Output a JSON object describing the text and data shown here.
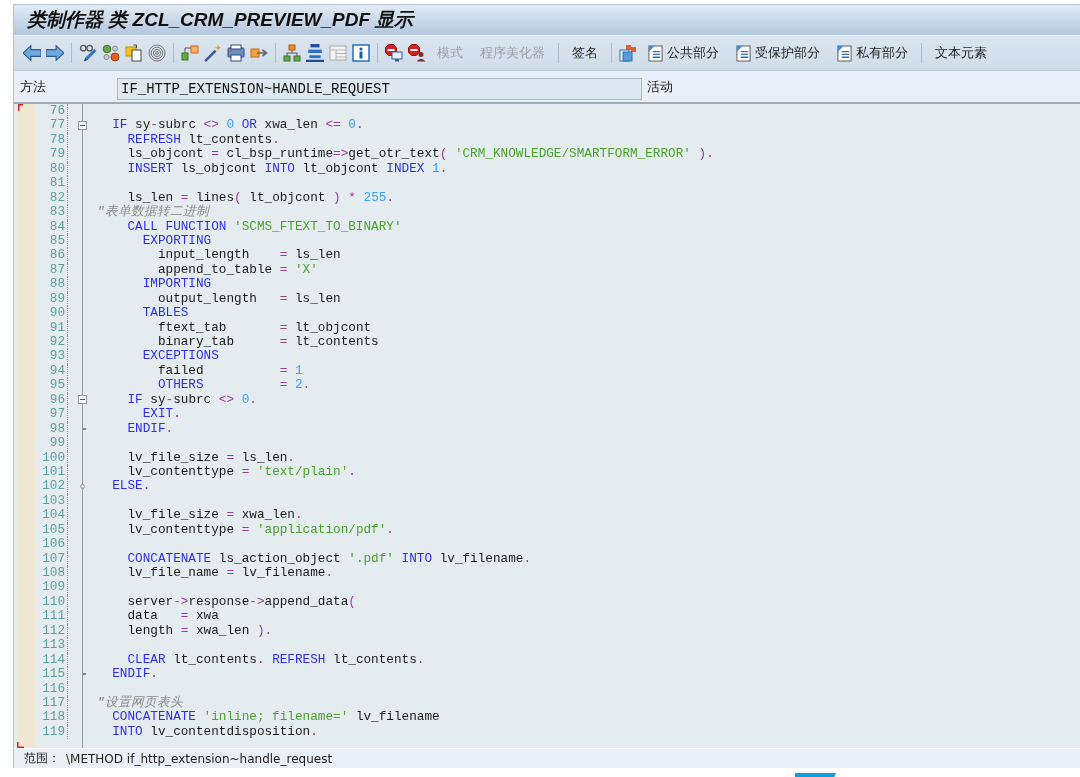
{
  "window": {
    "title": "类制作器 类 ZCL_CRM_PREVIEW_PDF 显示"
  },
  "toolbar": {
    "groups": [
      {
        "buttons": [
          {
            "label": "模式",
            "kind": "plain",
            "disabled": true
          },
          {
            "label": "程序美化器",
            "kind": "plain",
            "disabled": true
          }
        ]
      },
      {
        "buttons": [
          {
            "label": "签名",
            "kind": "plain",
            "disabled": false
          }
        ]
      },
      {
        "buttons": [
          {
            "label": "公共部分",
            "kind": "section",
            "disabled": false
          },
          {
            "label": "受保护部分",
            "kind": "section",
            "disabled": false
          },
          {
            "label": "私有部分",
            "kind": "section",
            "disabled": false
          }
        ]
      },
      {
        "buttons": [
          {
            "label": "文本元素",
            "kind": "plain",
            "disabled": false
          }
        ]
      }
    ]
  },
  "method": {
    "label": "方法",
    "value": "IF_HTTP_EXTENSION~HANDLE_REQUEST",
    "status": "活动"
  },
  "editor": {
    "lines": [
      {
        "number": "76",
        "kind": "line"
      },
      {
        "number": "77",
        "kind": "start",
        "tokens": [
          {
            "kind": "keyword",
            "text": "  IF"
          },
          {
            "kind": "plain",
            "text": " sy"
          },
          {
            "kind": "operator",
            "text": "-"
          },
          {
            "kind": "plain",
            "text": "subrc "
          },
          {
            "kind": "operator",
            "text": "<> "
          },
          {
            "kind": "number",
            "text": "0 "
          },
          {
            "kind": "keyword",
            "text": "OR"
          },
          {
            "kind": "plain",
            "text": " xwa_len "
          },
          {
            "kind": "operator",
            "text": "<= "
          },
          {
            "kind": "number",
            "text": "0"
          },
          {
            "kind": "operator",
            "text": "."
          }
        ]
      },
      {
        "number": "78",
        "kind": "line",
        "tokens": [
          {
            "kind": "keyword",
            "text": "    REFRESH"
          },
          {
            "kind": "plain",
            "text": " lt_contents"
          },
          {
            "kind": "operator",
            "text": "."
          }
        ]
      },
      {
        "number": "79",
        "kind": "line",
        "tokens": [
          {
            "kind": "plain",
            "text": "    ls_objcont "
          },
          {
            "kind": "operator",
            "text": "= "
          },
          {
            "kind": "plain",
            "text": "cl_bsp_runtime"
          },
          {
            "kind": "operator",
            "text": "=>"
          },
          {
            "kind": "plain",
            "text": "get_otr_text"
          },
          {
            "kind": "operator",
            "text": "( "
          },
          {
            "kind": "string",
            "text": "'CRM_KNOWLEDGE/SMARTFORM_ERROR'"
          },
          {
            "kind": "operator",
            "text": " )."
          }
        ]
      },
      {
        "number": "80",
        "kind": "line",
        "tokens": [
          {
            "kind": "keyword",
            "text": "    INSERT"
          },
          {
            "kind": "plain",
            "text": " ls_objcont "
          },
          {
            "kind": "keyword",
            "text": "INTO"
          },
          {
            "kind": "plain",
            "text": " lt_objcont "
          },
          {
            "kind": "keyword",
            "text": "INDEX"
          },
          {
            "kind": "number",
            "text": " 1"
          },
          {
            "kind": "operator",
            "text": "."
          }
        ]
      },
      {
        "number": "81",
        "kind": "line"
      },
      {
        "number": "82",
        "kind": "line",
        "tokens": [
          {
            "kind": "plain",
            "text": "    ls_len "
          },
          {
            "kind": "operator",
            "text": "= "
          },
          {
            "kind": "plain",
            "text": "lines"
          },
          {
            "kind": "operator",
            "text": "( "
          },
          {
            "kind": "plain",
            "text": "lt_objcont "
          },
          {
            "kind": "operator",
            "text": ") * "
          },
          {
            "kind": "number",
            "text": "255"
          },
          {
            "kind": "operator",
            "text": "."
          }
        ]
      },
      {
        "number": "83",
        "kind": "line",
        "tokens": [
          {
            "kind": "comment",
            "text": "\"表单数据转二进制"
          }
        ]
      },
      {
        "number": "84",
        "kind": "line",
        "tokens": [
          {
            "kind": "keyword",
            "text": "    CALL FUNCTION"
          },
          {
            "kind": "string",
            "text": " 'SCMS_FTEXT_TO_BINARY'"
          }
        ]
      },
      {
        "number": "85",
        "kind": "line",
        "tokens": [
          {
            "kind": "keyword",
            "text": "      EXPORTING"
          }
        ]
      },
      {
        "number": "86",
        "kind": "line",
        "tokens": [
          {
            "kind": "plain",
            "text": "        input_length    "
          },
          {
            "kind": "operator",
            "text": "= "
          },
          {
            "kind": "plain",
            "text": "ls_len"
          }
        ]
      },
      {
        "number": "87",
        "kind": "line",
        "tokens": [
          {
            "kind": "plain",
            "text": "        append_to_table "
          },
          {
            "kind": "operator",
            "text": "= "
          },
          {
            "kind": "string",
            "text": "'X'"
          }
        ]
      },
      {
        "number": "88",
        "kind": "line",
        "tokens": [
          {
            "kind": "keyword",
            "text": "      IMPORTING"
          }
        ]
      },
      {
        "number": "89",
        "kind": "line",
        "tokens": [
          {
            "kind": "plain",
            "text": "        output_length   "
          },
          {
            "kind": "operator",
            "text": "= "
          },
          {
            "kind": "plain",
            "text": "ls_len"
          }
        ]
      },
      {
        "number": "90",
        "kind": "line",
        "tokens": [
          {
            "kind": "keyword",
            "text": "      TABLES"
          }
        ]
      },
      {
        "number": "91",
        "kind": "line",
        "tokens": [
          {
            "kind": "plain",
            "text": "        ftext_tab       "
          },
          {
            "kind": "operator",
            "text": "= "
          },
          {
            "kind": "plain",
            "text": "lt_objcont"
          }
        ]
      },
      {
        "number": "92",
        "kind": "line",
        "tokens": [
          {
            "kind": "plain",
            "text": "        binary_tab      "
          },
          {
            "kind": "operator",
            "text": "= "
          },
          {
            "kind": "plain",
            "text": "lt_contents"
          }
        ]
      },
      {
        "number": "93",
        "kind": "line",
        "tokens": [
          {
            "kind": "keyword",
            "text": "      EXCEPTIONS"
          }
        ]
      },
      {
        "number": "94",
        "kind": "line",
        "tokens": [
          {
            "kind": "plain",
            "text": "        failed          "
          },
          {
            "kind": "operator",
            "text": "= "
          },
          {
            "kind": "number",
            "text": "1"
          }
        ]
      },
      {
        "number": "95",
        "kind": "line",
        "tokens": [
          {
            "kind": "keyword",
            "text": "        OTHERS"
          },
          {
            "kind": "operator",
            "text": "          = "
          },
          {
            "kind": "number",
            "text": "2"
          },
          {
            "kind": "operator",
            "text": "."
          }
        ]
      },
      {
        "number": "96",
        "kind": "start",
        "tokens": [
          {
            "kind": "keyword",
            "text": "    IF"
          },
          {
            "kind": "plain",
            "text": " sy"
          },
          {
            "kind": "operator",
            "text": "-"
          },
          {
            "kind": "plain",
            "text": "subrc "
          },
          {
            "kind": "operator",
            "text": "<> "
          },
          {
            "kind": "number",
            "text": "0"
          },
          {
            "kind": "operator",
            "text": "."
          }
        ]
      },
      {
        "number": "97",
        "kind": "line",
        "tokens": [
          {
            "kind": "keyword",
            "text": "      EXIT"
          },
          {
            "kind": "operator",
            "text": "."
          }
        ]
      },
      {
        "number": "98",
        "kind": "end",
        "tokens": [
          {
            "kind": "keyword",
            "text": "    ENDIF"
          },
          {
            "kind": "operator",
            "text": "."
          }
        ]
      },
      {
        "number": "99",
        "kind": "line"
      },
      {
        "number": "100",
        "kind": "line",
        "tokens": [
          {
            "kind": "plain",
            "text": "    lv_file_size "
          },
          {
            "kind": "operator",
            "text": "= "
          },
          {
            "kind": "plain",
            "text": "ls_len"
          },
          {
            "kind": "operator",
            "text": "."
          }
        ]
      },
      {
        "number": "101",
        "kind": "line",
        "tokens": [
          {
            "kind": "plain",
            "text": "    lv_contenttype "
          },
          {
            "kind": "operator",
            "text": "= "
          },
          {
            "kind": "string",
            "text": "'text/plain'"
          },
          {
            "kind": "operator",
            "text": "."
          }
        ]
      },
      {
        "number": "102",
        "kind": "middle",
        "tokens": [
          {
            "kind": "keyword",
            "text": "  ELSE"
          },
          {
            "kind": "operator",
            "text": "."
          }
        ]
      },
      {
        "number": "103",
        "kind": "line"
      },
      {
        "number": "104",
        "kind": "line",
        "tokens": [
          {
            "kind": "plain",
            "text": "    lv_file_size "
          },
          {
            "kind": "operator",
            "text": "= "
          },
          {
            "kind": "plain",
            "text": "xwa_len"
          },
          {
            "kind": "operator",
            "text": "."
          }
        ]
      },
      {
        "number": "105",
        "kind": "line",
        "tokens": [
          {
            "kind": "plain",
            "text": "    lv_contenttype "
          },
          {
            "kind": "operator",
            "text": "= "
          },
          {
            "kind": "string",
            "text": "'application/pdf'"
          },
          {
            "kind": "operator",
            "text": "."
          }
        ]
      },
      {
        "number": "106",
        "kind": "line"
      },
      {
        "number": "107",
        "kind": "line",
        "tokens": [
          {
            "kind": "keyword",
            "text": "    CONCATENATE"
          },
          {
            "kind": "plain",
            "text": " ls_action_object "
          },
          {
            "kind": "string",
            "text": "'.pdf' "
          },
          {
            "kind": "keyword",
            "text": "INTO"
          },
          {
            "kind": "plain",
            "text": " lv_filename"
          },
          {
            "kind": "operator",
            "text": "."
          }
        ]
      },
      {
        "number": "108",
        "kind": "line",
        "tokens": [
          {
            "kind": "plain",
            "text": "    lv_file_name "
          },
          {
            "kind": "operator",
            "text": "= "
          },
          {
            "kind": "plain",
            "text": "lv_filename"
          },
          {
            "kind": "operator",
            "text": "."
          }
        ]
      },
      {
        "number": "109",
        "kind": "line"
      },
      {
        "number": "110",
        "kind": "line",
        "tokens": [
          {
            "kind": "plain",
            "text": "    server"
          },
          {
            "kind": "operator",
            "text": "->"
          },
          {
            "kind": "plain",
            "text": "response"
          },
          {
            "kind": "operator",
            "text": "->"
          },
          {
            "kind": "plain",
            "text": "append_data"
          },
          {
            "kind": "operator",
            "text": "("
          }
        ]
      },
      {
        "number": "111",
        "kind": "line",
        "tokens": [
          {
            "kind": "plain",
            "text": "    data   "
          },
          {
            "kind": "operator",
            "text": "= "
          },
          {
            "kind": "plain",
            "text": "xwa"
          }
        ]
      },
      {
        "number": "112",
        "kind": "line",
        "tokens": [
          {
            "kind": "plain",
            "text": "    length "
          },
          {
            "kind": "operator",
            "text": "= "
          },
          {
            "kind": "plain",
            "text": "xwa_len "
          },
          {
            "kind": "operator",
            "text": ")."
          }
        ]
      },
      {
        "number": "113",
        "kind": "line"
      },
      {
        "number": "114",
        "kind": "line",
        "tokens": [
          {
            "kind": "keyword",
            "text": "    CLEAR"
          },
          {
            "kind": "plain",
            "text": " lt_contents"
          },
          {
            "kind": "operator",
            "text": ". "
          },
          {
            "kind": "keyword",
            "text": "REFRESH"
          },
          {
            "kind": "plain",
            "text": " lt_contents"
          },
          {
            "kind": "operator",
            "text": "."
          }
        ]
      },
      {
        "number": "115",
        "kind": "end",
        "tokens": [
          {
            "kind": "keyword",
            "text": "  ENDIF"
          },
          {
            "kind": "operator",
            "text": "."
          }
        ]
      },
      {
        "number": "116",
        "kind": "line"
      },
      {
        "number": "117",
        "kind": "line",
        "tokens": [
          {
            "kind": "comment",
            "text": "\"设置网页表头"
          }
        ]
      },
      {
        "number": "118",
        "kind": "line",
        "tokens": [
          {
            "kind": "keyword",
            "text": "  CONCATENATE"
          },
          {
            "kind": "string",
            "text": " 'inline; filename='"
          },
          {
            "kind": "plain",
            "text": " lv_filename"
          }
        ]
      },
      {
        "number": "119",
        "kind": "line",
        "tokens": [
          {
            "kind": "keyword",
            "text": "  INTO"
          },
          {
            "kind": "plain",
            "text": " lv_contentdisposition"
          },
          {
            "kind": "operator",
            "text": "."
          }
        ]
      }
    ]
  },
  "status_bar": {
    "label": "范围：",
    "value": "\\METHOD if_http_extension~handle_request"
  }
}
